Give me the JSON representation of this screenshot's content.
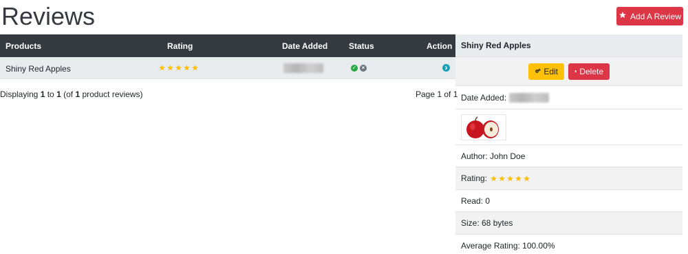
{
  "header": {
    "title": "Reviews",
    "add_button_label": "Add A Review"
  },
  "table": {
    "columns": {
      "products": "Products",
      "rating": "Rating",
      "date_added": "Date Added",
      "status": "Status",
      "action": "Action"
    },
    "rows": [
      {
        "product": "Shiny Red Apples",
        "rating": 5,
        "date_added": "",
        "status_active": true
      }
    ]
  },
  "pagination": {
    "prefix": "Displaying ",
    "from": "1",
    "to_word": " to ",
    "to": "1",
    "of_open": " (of ",
    "total": "1",
    "suffix": " product reviews)",
    "page_text": "Page 1 of 1"
  },
  "details": {
    "title": "Shiny Red Apples",
    "edit_label": "Edit",
    "delete_label": "Delete",
    "date_added_label": "Date Added:",
    "author": "Author: John Doe",
    "rating_label": "Rating:",
    "rating": 5,
    "read": "Read: 0",
    "size": "Size: 68 bytes",
    "average_rating": "Average Rating: 100.00%"
  },
  "colors": {
    "dark_header": "#343a40",
    "danger": "#dc3545",
    "warning": "#ffc107",
    "star": "#ffc107",
    "success": "#28a745",
    "info": "#17a2b8"
  },
  "icons": {
    "add": "star-icon",
    "edit": "cogs-icon",
    "delete": "trash-icon",
    "action": "chevron-circle-right-icon"
  }
}
